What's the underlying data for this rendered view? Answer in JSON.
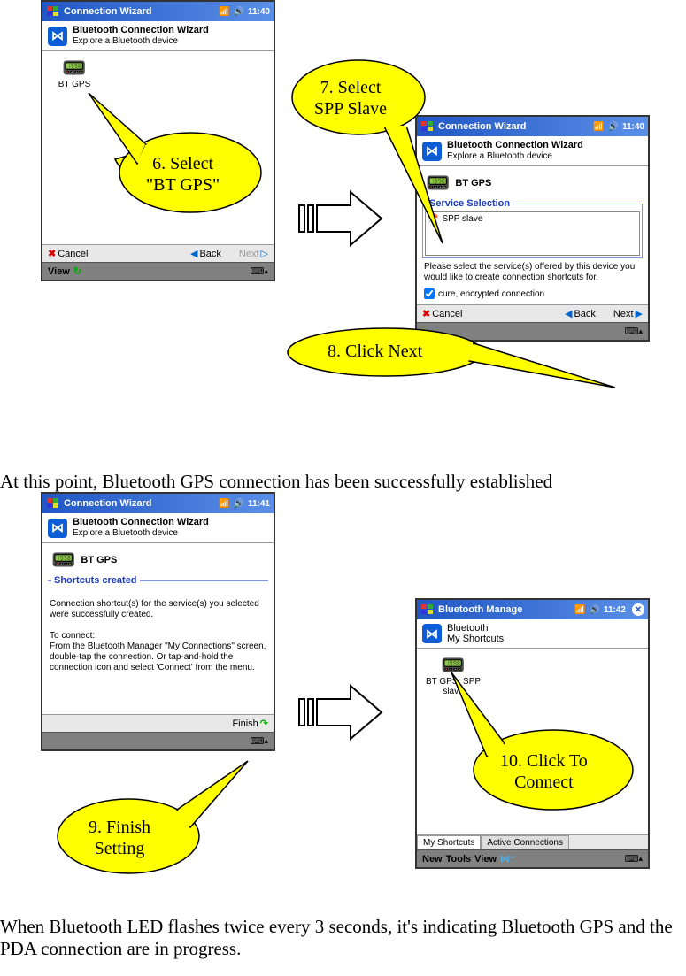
{
  "screens": {
    "s1": {
      "titlebar_title": "Connection Wizard",
      "time": "11:40",
      "wizard_title": "Bluetooth Connection Wizard",
      "wizard_sub": "Explore a Bluetooth device",
      "device_label": "BT GPS",
      "cancel": "Cancel",
      "back": "Back",
      "next": "Next",
      "view": "View"
    },
    "s2": {
      "titlebar_title": "Connection Wizard",
      "time": "11:40",
      "wizard_title": "Bluetooth Connection Wizard",
      "wizard_sub": "Explore a Bluetooth device",
      "device_label": "BT GPS",
      "group_title": "Service Selection",
      "service_item": "SPP slave",
      "info_text": "Please select the service(s) offered by this device you would like to create connection shortcuts for.",
      "checkbox_label": "cure, encrypted connection",
      "cancel": "Cancel",
      "back": "Back",
      "next": "Next"
    },
    "s3": {
      "titlebar_title": "Connection Wizard",
      "time": "11:41",
      "wizard_title": "Bluetooth Connection Wizard",
      "wizard_sub": "Explore a Bluetooth device",
      "device_label": "BT GPS",
      "group_title": "Shortcuts created",
      "body_text": "Connection shortcut(s) for the service(s) you selected were successfully created.\n\nTo connect:\nFrom the Bluetooth Manager \"My Connections\" screen, double-tap the connection. Or tap-and-hold the connection icon and select 'Connect' from the menu.",
      "finish": "Finish"
    },
    "s4": {
      "titlebar_title": "Bluetooth Manage",
      "time": "11:42",
      "header_title": "Bluetooth",
      "header_sub": "My Shortcuts",
      "shortcut_label": "BT GPS: SPP slave",
      "tab1": "My Shortcuts",
      "tab2": "Active Connections",
      "new": "New",
      "tools": "Tools",
      "view": "View"
    }
  },
  "callouts": {
    "c6": "6. Select \"BT GPS\"",
    "c7": "7. Select SPP Slave",
    "c8": "8. Click Next",
    "c9": "9. Finish Setting",
    "c10": "10. Click To Connect"
  },
  "body": {
    "p1": "At this point, Bluetooth GPS connection has been successfully established",
    "p2": "When Bluetooth LED flashes twice every 3 seconds, it's indicating Bluetooth GPS and the PDA connection are in progress."
  }
}
